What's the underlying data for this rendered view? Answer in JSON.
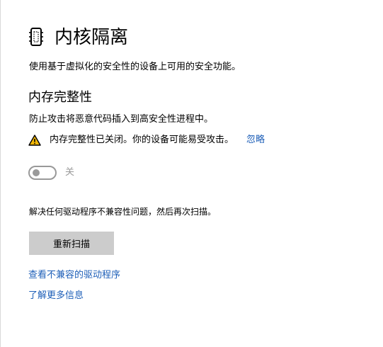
{
  "page": {
    "title": "内核隔离",
    "icon": "chip-icon",
    "description": "使用基于虚拟化的安全性的设备上可用的安全功能。"
  },
  "memory_integrity": {
    "title": "内存完整性",
    "description": "防止攻击将恶意代码插入到高安全性进程中。",
    "warning": {
      "icon": "warning-icon",
      "text": "内存完整性已关闭。你的设备可能易受攻击。",
      "ignore_label": "忽略"
    },
    "toggle": {
      "state": "off",
      "label": "关"
    }
  },
  "drivers": {
    "resolve_text": "解决任何驱动程序不兼容性问题，然后再次扫描。",
    "rescan_label": "重新扫描",
    "view_incompatible_label": "查看不兼容的驱动程序",
    "learn_more_label": "了解更多信息"
  },
  "colors": {
    "link": "#1e5fb8",
    "button_bg": "#cccccc",
    "warning_fill": "#f2b705",
    "toggle_off": "#9a9a9a"
  }
}
